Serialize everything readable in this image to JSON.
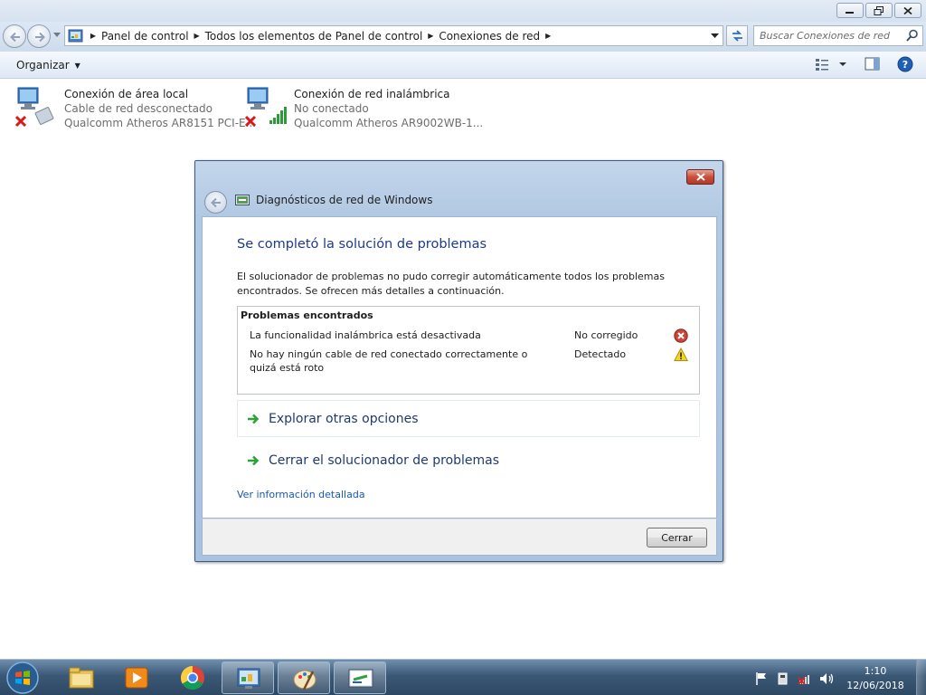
{
  "breadcrumb": [
    "Panel de control",
    "Todos los elementos de Panel de control",
    "Conexiones de red"
  ],
  "search": {
    "placeholder": "Buscar Conexiones de red"
  },
  "toolbar": {
    "organize_label": "Organizar"
  },
  "connections": [
    {
      "name": "Conexión de área local",
      "status": "Cable de red desconectado",
      "device": "Qualcomm Atheros AR8151 PCI-E...",
      "icon": "network-cable-icon"
    },
    {
      "name": "Conexión de red inalámbrica",
      "status": "No conectado",
      "device": "Qualcomm Atheros AR9002WB-1...",
      "icon": "wireless-network-icon"
    }
  ],
  "dialog": {
    "title": "Diagnósticos de red de Windows",
    "heading": "Se completó la solución de problemas",
    "description": "El solucionador de problemas no pudo corregir automáticamente todos los problemas encontrados. Se ofrecen más detalles a continuación.",
    "problems_header": "Problemas encontrados",
    "problems": [
      {
        "description": "La funcionalidad inalámbrica está desactivada",
        "status": "No corregido",
        "icon": "error-icon"
      },
      {
        "description": "No hay ningún cable de red conectado correctamente o quizá está roto",
        "status": "Detectado",
        "icon": "warning-icon"
      }
    ],
    "options": [
      "Explorar otras opciones",
      "Cerrar el solucionador de problemas"
    ],
    "detail_link": "Ver información detallada",
    "close_button": "Cerrar"
  },
  "taskbar": {
    "time": "1:10",
    "date": "12/06/2018"
  },
  "colors": {
    "heading": "#1d3a8a",
    "link": "#1a58b0",
    "taskbar": "#3b5875",
    "dialog_frame": "#b2c9e3"
  }
}
